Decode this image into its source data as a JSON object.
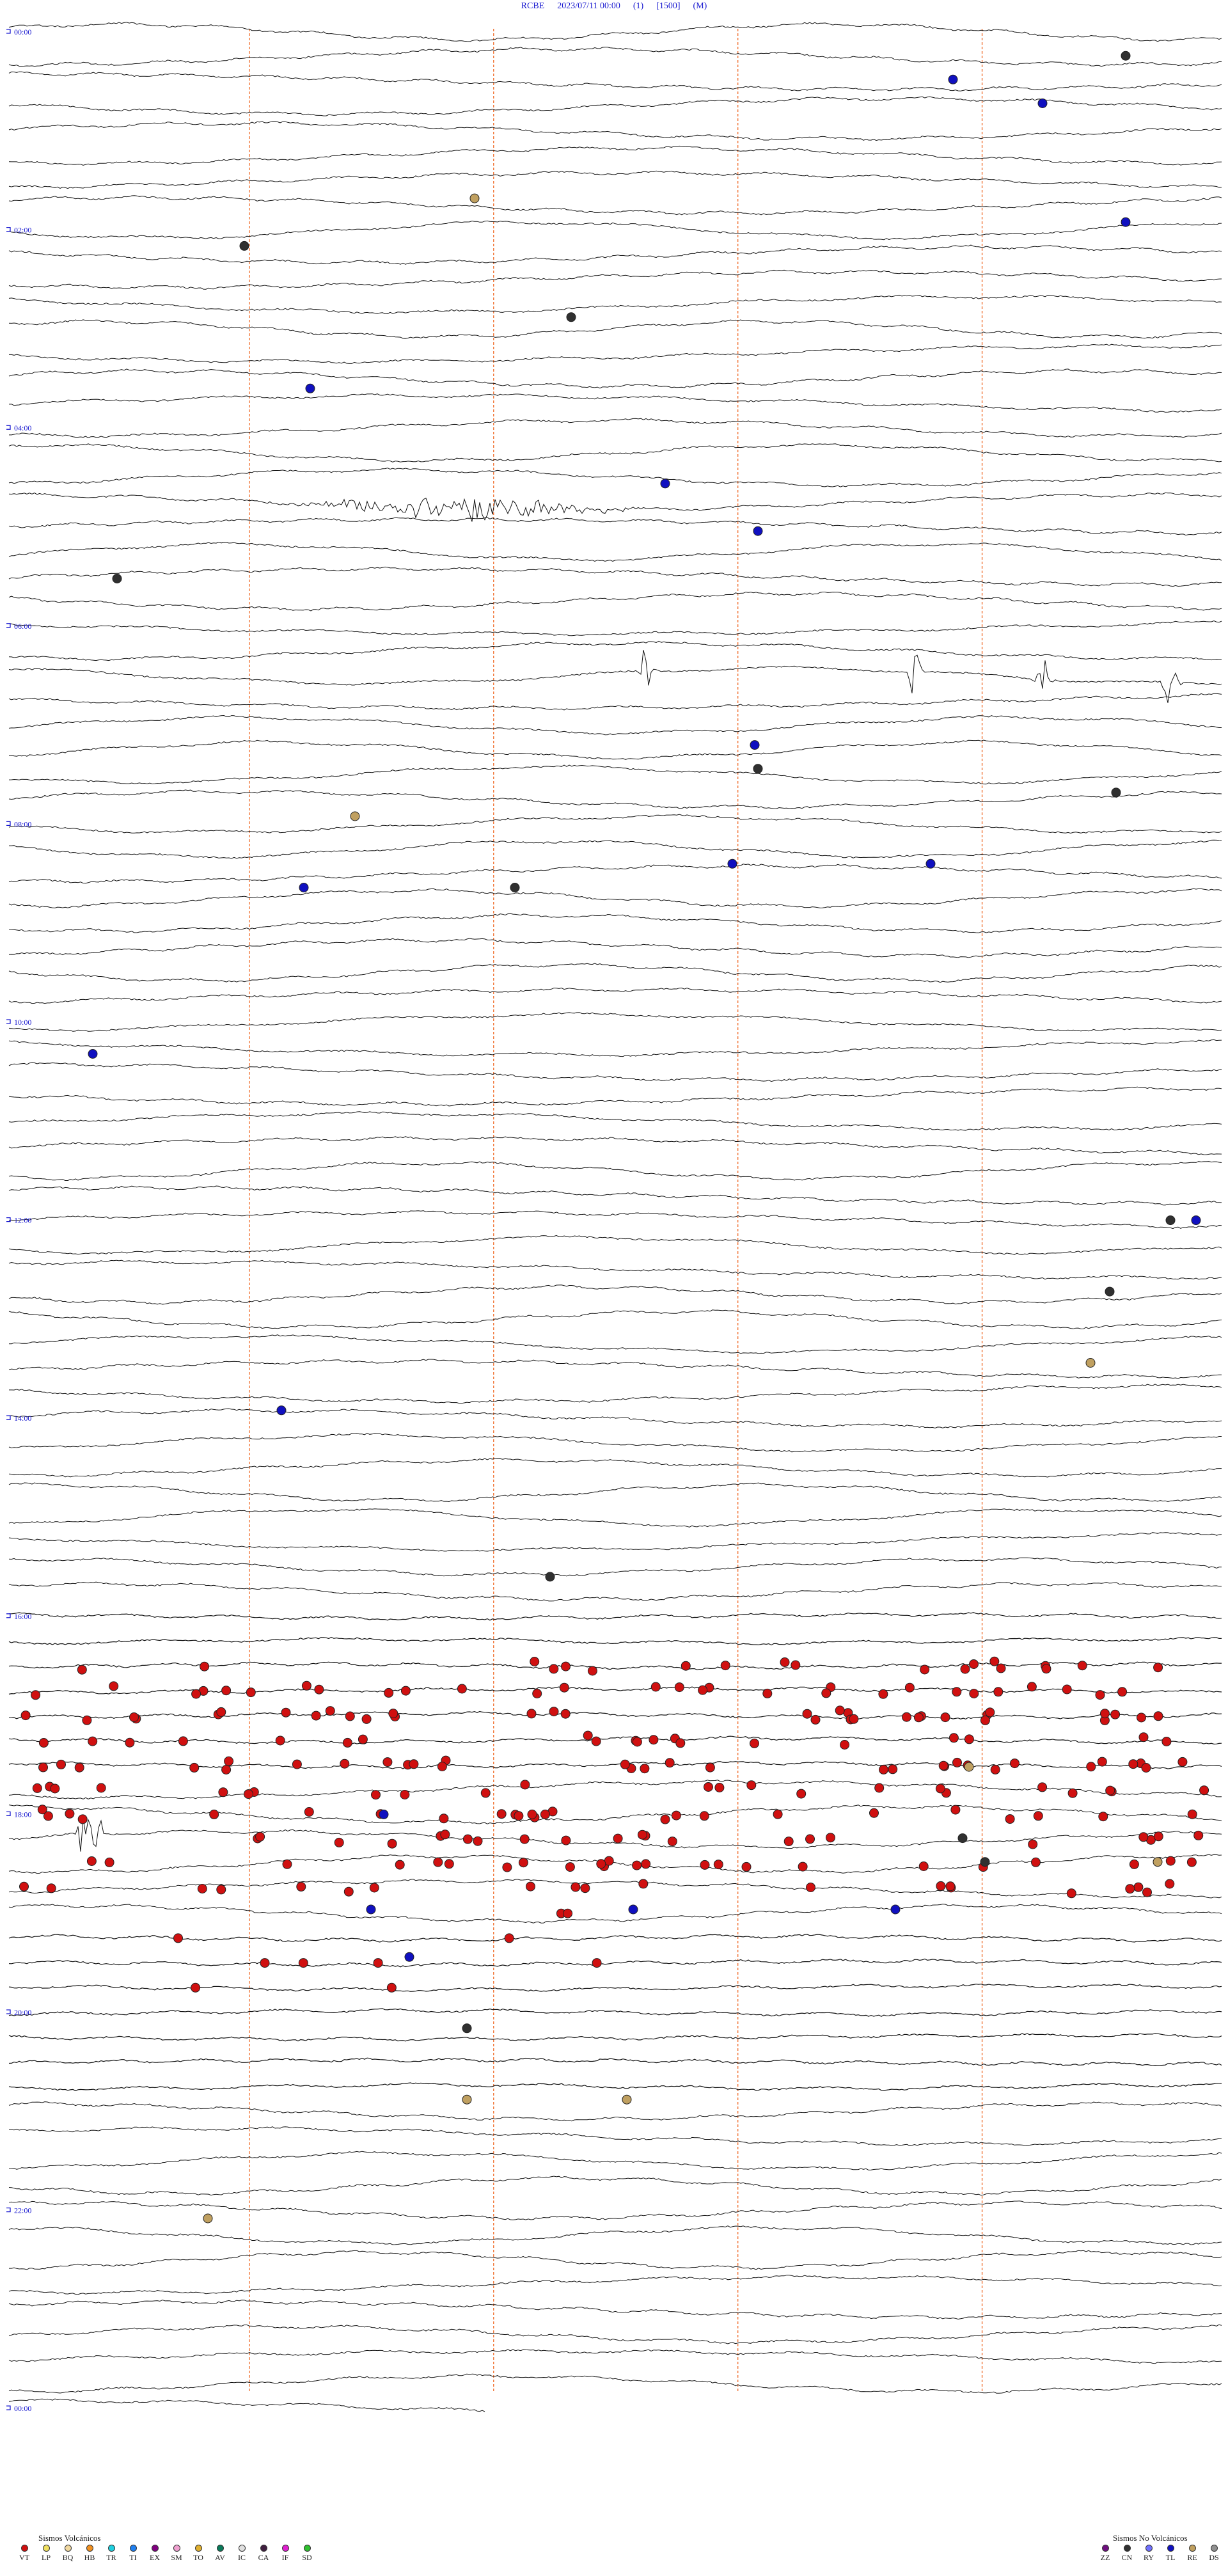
{
  "header": {
    "station": "RCBE",
    "datetime": "2023/07/11 00:00",
    "component": "(1)",
    "scale": "[1500]",
    "unit": "(M)"
  },
  "chart_data": {
    "type": "helicorder",
    "hour_labels": [
      "00:00",
      "02:00",
      "04:00",
      "06:00",
      "08:00",
      "10:00",
      "12:00",
      "14:00",
      "16:00",
      "18:00",
      "20:00",
      "22:00",
      "00:00"
    ],
    "traces_per_hour": 4,
    "total_traces": 96,
    "hours_span": 24,
    "grid": true,
    "vertical_markers": 4,
    "colors": {
      "trace": "#111111",
      "marker_line": "#f07030",
      "label": "#1a1ad0",
      "VT": "#d01010",
      "LP": "#f0e060",
      "BQ": "#f0d8a0",
      "HB": "#f09020",
      "TR": "#20d0e0",
      "TI": "#2080f0",
      "EX": "#800080",
      "SM": "#f0a0d0",
      "TO": "#e0b030",
      "AV": "#0a7a5a",
      "IC": "#c0c0c0",
      "CA": "#402040",
      "IF": "#e020d0",
      "SD": "#30c030",
      "ZZ": "#701080",
      "CN": "#303030",
      "RY": "#7070ff",
      "TL": "#1010c0",
      "RE": "#c0a060",
      "DS": "#909090"
    },
    "events": {
      "gray_minutes": [
        1260,
        1302,
        1305,
        1320,
        1392,
        1416,
        1480,
        1484,
        1500,
        1509,
        1560,
        1568,
        1600,
        1620,
        1700,
        1760
      ],
      "blue_minutes": [
        1150,
        1166,
        1207,
        1330,
        1360,
        1410,
        1458,
        1470,
        1520,
        1600,
        1700,
        1728,
        1840
      ],
      "tan_minutes": [
        1020,
        1530,
        1610,
        1650,
        1760
      ]
    }
  },
  "legend_volcanic": {
    "title": "Sismos Volcánicos",
    "items": [
      {
        "code": "VT",
        "color": "#d01010"
      },
      {
        "code": "LP",
        "color": "#f0e060"
      },
      {
        "code": "BQ",
        "color": "#f0d8a0"
      },
      {
        "code": "HB",
        "color": "#f09020"
      },
      {
        "code": "TR",
        "color": "#20d0e0"
      },
      {
        "code": "TI",
        "color": "#2080f0"
      },
      {
        "code": "EX",
        "color": "#800080"
      },
      {
        "code": "SM",
        "color": "#f0a0d0"
      },
      {
        "code": "TO",
        "color": "#e0b030"
      },
      {
        "code": "AV",
        "color": "#0a7a5a"
      },
      {
        "code": "IC",
        "color": "#e0e0e0"
      },
      {
        "code": "CA",
        "color": "#402040"
      },
      {
        "code": "IF",
        "color": "#e020d0"
      },
      {
        "code": "SD",
        "color": "#30c030"
      }
    ]
  },
  "legend_nonvolcanic": {
    "title": "Sismos No Volcánicos",
    "items": [
      {
        "code": "ZZ",
        "color": "#701080"
      },
      {
        "code": "CN",
        "color": "#303030"
      },
      {
        "code": "RY",
        "color": "#7070ff"
      },
      {
        "code": "TL",
        "color": "#1010c0"
      },
      {
        "code": "RE",
        "color": "#c0a060"
      },
      {
        "code": "DS",
        "color": "#909090"
      }
    ]
  }
}
